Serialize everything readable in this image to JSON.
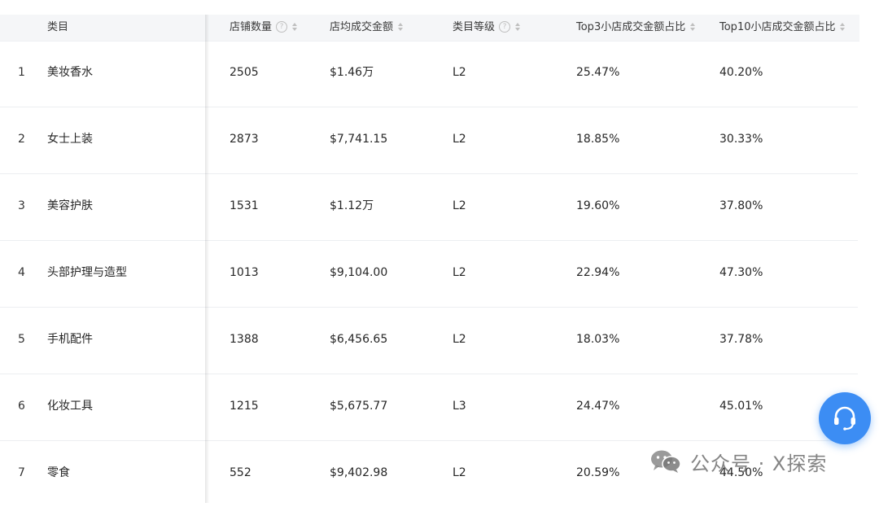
{
  "table": {
    "headers": {
      "category": "类目",
      "store_count": "店铺数量",
      "avg_sales": "店均成交金额",
      "level": "类目等级",
      "top3_share": "Top3小店成交金额占比",
      "top10_share": "Top10小店成交金额占比"
    },
    "rows": [
      {
        "idx": "1",
        "category": "美妆香水",
        "stores": "2505",
        "avg": "$1.46万",
        "level": "L2",
        "top3": "25.47%",
        "top10": "40.20%"
      },
      {
        "idx": "2",
        "category": "女士上装",
        "stores": "2873",
        "avg": "$7,741.15",
        "level": "L2",
        "top3": "18.85%",
        "top10": "30.33%"
      },
      {
        "idx": "3",
        "category": "美容护肤",
        "stores": "1531",
        "avg": "$1.12万",
        "level": "L2",
        "top3": "19.60%",
        "top10": "37.80%"
      },
      {
        "idx": "4",
        "category": "头部护理与造型",
        "stores": "1013",
        "avg": "$9,104.00",
        "level": "L2",
        "top3": "22.94%",
        "top10": "47.30%"
      },
      {
        "idx": "5",
        "category": "手机配件",
        "stores": "1388",
        "avg": "$6,456.65",
        "level": "L2",
        "top3": "18.03%",
        "top10": "37.78%"
      },
      {
        "idx": "6",
        "category": "化妆工具",
        "stores": "1215",
        "avg": "$5,675.77",
        "level": "L3",
        "top3": "24.47%",
        "top10": "45.01%"
      },
      {
        "idx": "7",
        "category": "零食",
        "stores": "552",
        "avg": "$9,402.98",
        "level": "L2",
        "top3": "20.59%",
        "top10": "44.50%"
      }
    ]
  },
  "help_icon_glyph": "?",
  "watermark": {
    "text": "公众号 · X探索",
    "icon": "wechat-icon"
  },
  "support_button": {
    "icon": "headset-icon"
  },
  "colors": {
    "header_bg": "#f5f6f8",
    "accent": "#3c8df4",
    "row_border": "#eceef1"
  }
}
